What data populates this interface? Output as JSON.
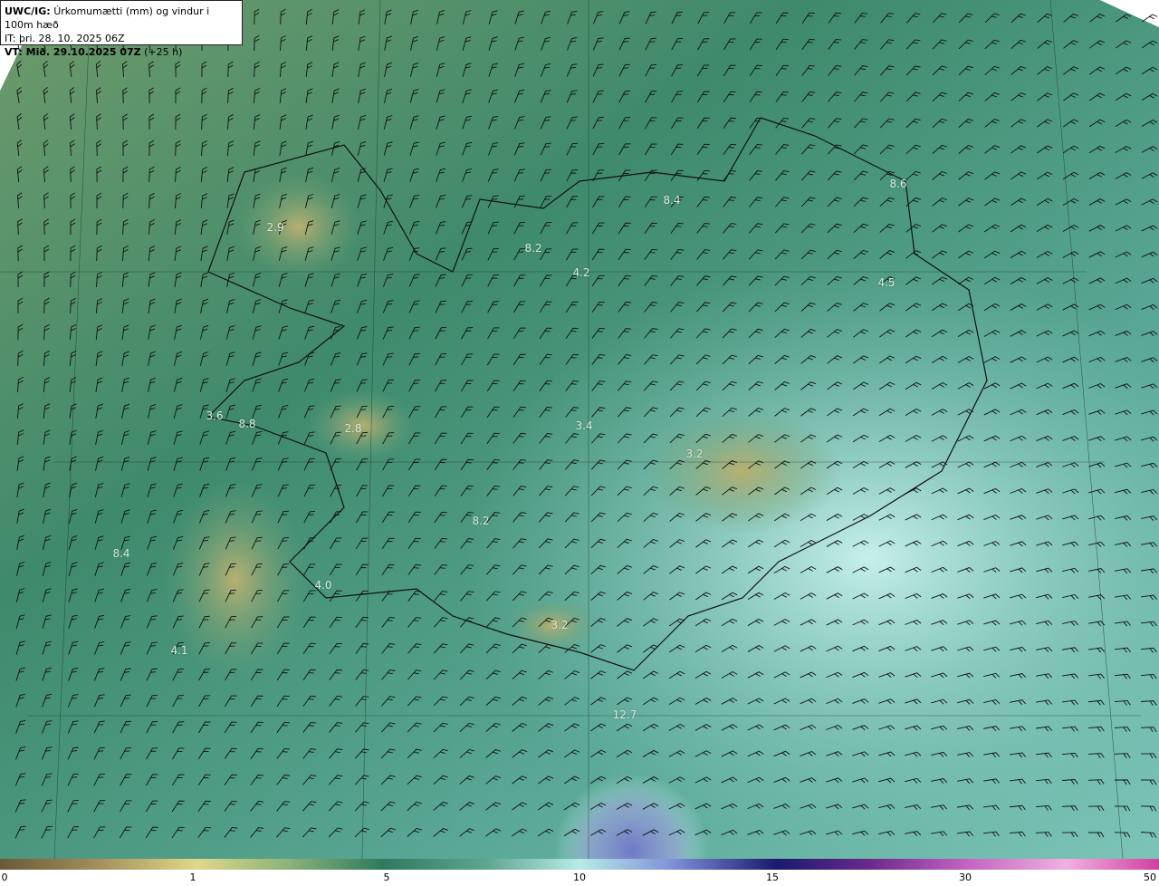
{
  "header": {
    "model_prefix": "UWC/IG:",
    "title": "Úrkomumætti (mm) og vindur i 100m hæð",
    "it_line": "IT: þri. 28. 10. 2025 06Z",
    "vt_prefix": "VT: Mið. 29.10.2025 07Z",
    "vt_suffix": "(+25 h)"
  },
  "colorbar": {
    "ticks": [
      "0",
      "1",
      "5",
      "10",
      "15",
      "30",
      "50"
    ],
    "colors": [
      "#6b5a3a",
      "#b8a25c",
      "#e0d78a",
      "#8ab27a",
      "#2f7a5e",
      "#5fa690",
      "#b7ece6",
      "#6070c8",
      "#1a1a6e",
      "#6a2a8a",
      "#c060c0",
      "#f0b0e0",
      "#d040a0"
    ]
  },
  "max_labels": [
    "2.9",
    "8.2",
    "4.2",
    "8.4",
    "8.6",
    "4.5",
    "3.6",
    "8.8",
    "2.8",
    "3.4",
    "3.2",
    "8.2",
    "8.4",
    "4.0",
    "3.2",
    "4.1",
    "12.7"
  ]
}
